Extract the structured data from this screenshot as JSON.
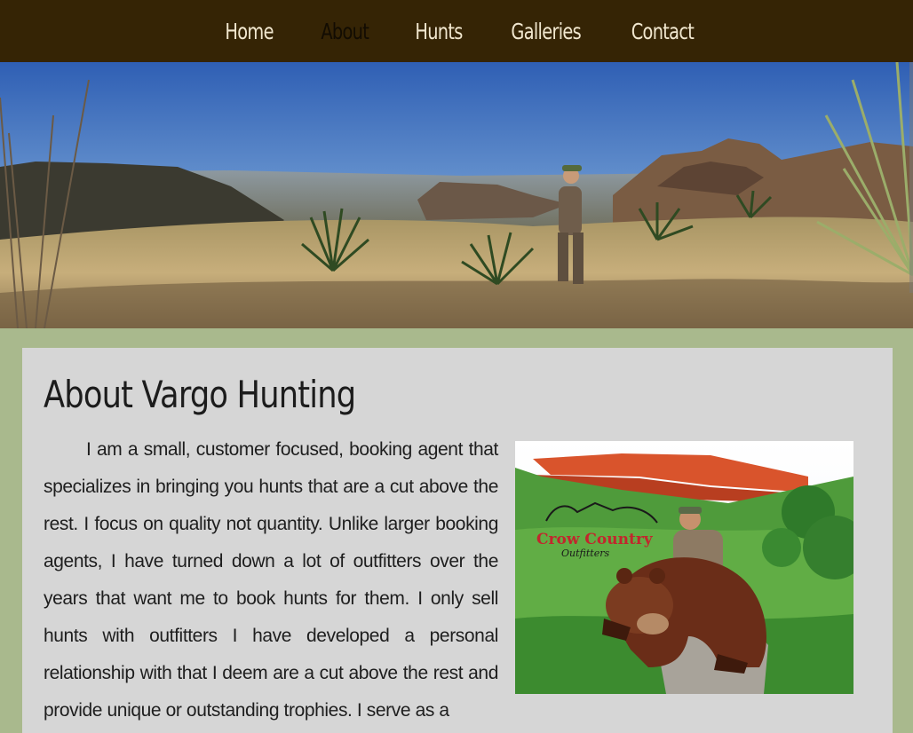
{
  "nav": {
    "items": [
      {
        "label": "Home",
        "active": false
      },
      {
        "label": "About",
        "active": true
      },
      {
        "label": "Hunts",
        "active": false
      },
      {
        "label": "Galleries",
        "active": false
      },
      {
        "label": "Contact",
        "active": false
      }
    ]
  },
  "about": {
    "title": "About Vargo Hunting",
    "paragraph": "I am a small, customer focused, booking agent that specializes in bringing you hunts that are a cut above the rest. I focus on quality not quantity. Unlike larger booking agents, I have turned down a lot of outfitters over the years that want me to book hunts for them. I only sell hunts with outfitters I have developed a personal relationship with that I deem are a cut above the rest and provide unique or outstanding trophies. I serve as a"
  },
  "photo": {
    "logo_line1": "Crow Country",
    "logo_line2": "Outfitters"
  },
  "colors": {
    "nav_bg": "#352405",
    "nav_text": "#f1e7cf",
    "nav_active": "#120c02",
    "page_bg": "#a9b98d",
    "card_bg": "#d6d6d6"
  }
}
